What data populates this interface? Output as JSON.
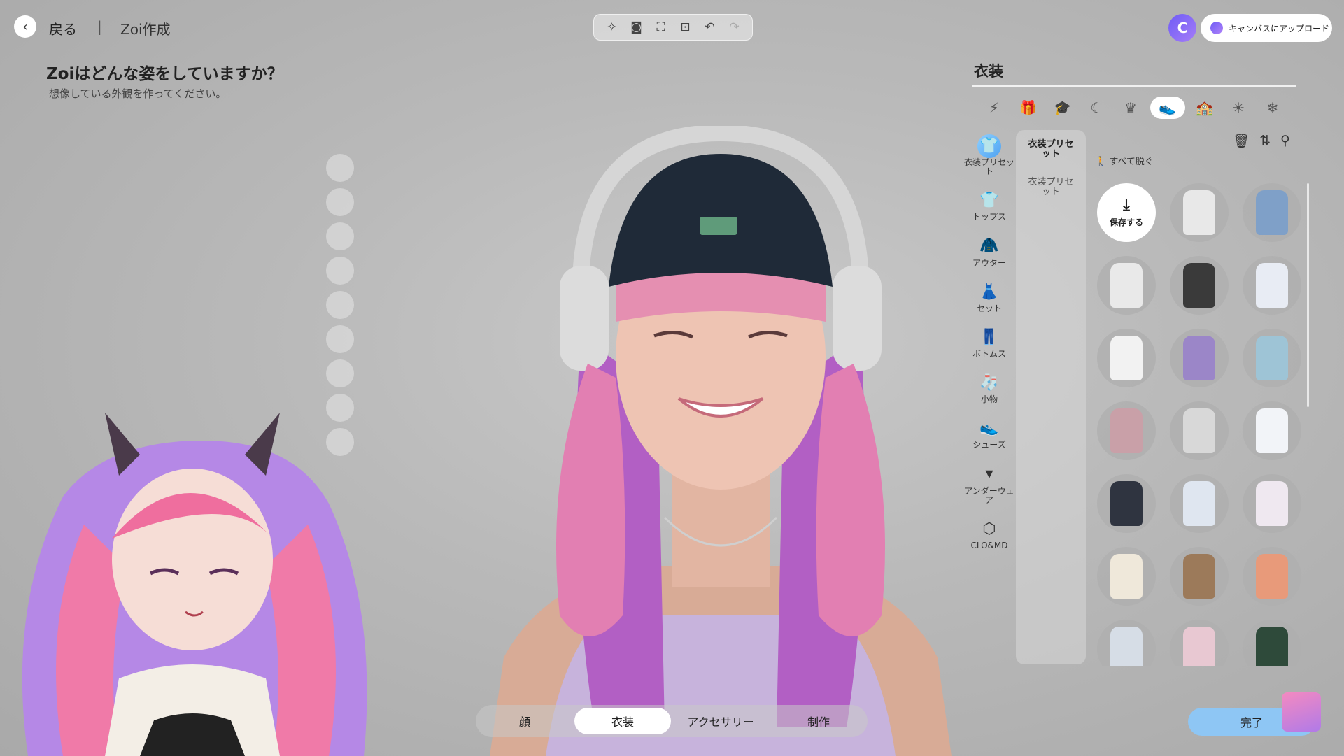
{
  "header": {
    "back_label": "戻る",
    "separator": "|",
    "breadcrumb": "Zoi作成",
    "upload_label": "キャンバスにアップロード",
    "toolbar_icons": [
      "sparkle-icon",
      "camera-icon",
      "focus-icon",
      "face-focus-icon",
      "undo-icon",
      "redo-icon"
    ]
  },
  "prompt": {
    "question": "Zoiはどんな姿をしていますか？",
    "subtitle": "想像している外観を作ってください。"
  },
  "bottom_tabs": [
    {
      "label": "顔"
    },
    {
      "label": "衣装"
    },
    {
      "label": "アクセサリー"
    },
    {
      "label": "制作"
    }
  ],
  "panel": {
    "title": "衣装",
    "category_icons": [
      "magic-icon",
      "gift-icon",
      "graduation-cap-icon",
      "moon-icon",
      "crown-icon",
      "shoe-icon",
      "school-icon",
      "sun-icon",
      "snowflake-icon"
    ],
    "menu": [
      {
        "label": "衣装プリセット",
        "icon": "preset-icon"
      },
      {
        "label": "トップス",
        "icon": "shirt-icon"
      },
      {
        "label": "アウター",
        "icon": "jacket-icon"
      },
      {
        "label": "セット",
        "icon": "dress-icon"
      },
      {
        "label": "ボトムス",
        "icon": "pants-icon"
      },
      {
        "label": "小物",
        "icon": "sock-icon"
      },
      {
        "label": "シューズ",
        "icon": "shoes-icon"
      },
      {
        "label": "アンダーウェア",
        "icon": "underwear-icon"
      },
      {
        "label": "CLO&MD",
        "icon": "clo-icon"
      }
    ],
    "sub_active": "衣装プリセット",
    "sub_item": "衣装プリセット",
    "take_off_label": "すべて脱ぐ",
    "save_label": "保存する",
    "outfit_colors": [
      "#e8e8e8",
      "#7fa0c8",
      "#e9e9e9",
      "#3a3a3a",
      "#e8ecf4",
      "#f2f2f2",
      "#9b86c8",
      "#9ec4d6",
      "#c9a0a8",
      "#d8d8d8",
      "#f2f4f8",
      "#2f3440",
      "#dfe6f0",
      "#efe8f0",
      "#efe8da",
      "#9c7a5a",
      "#e89a7a",
      "#d6dde6",
      "#e8c8d2",
      "#2e4a3a"
    ]
  },
  "done_label": "完了"
}
